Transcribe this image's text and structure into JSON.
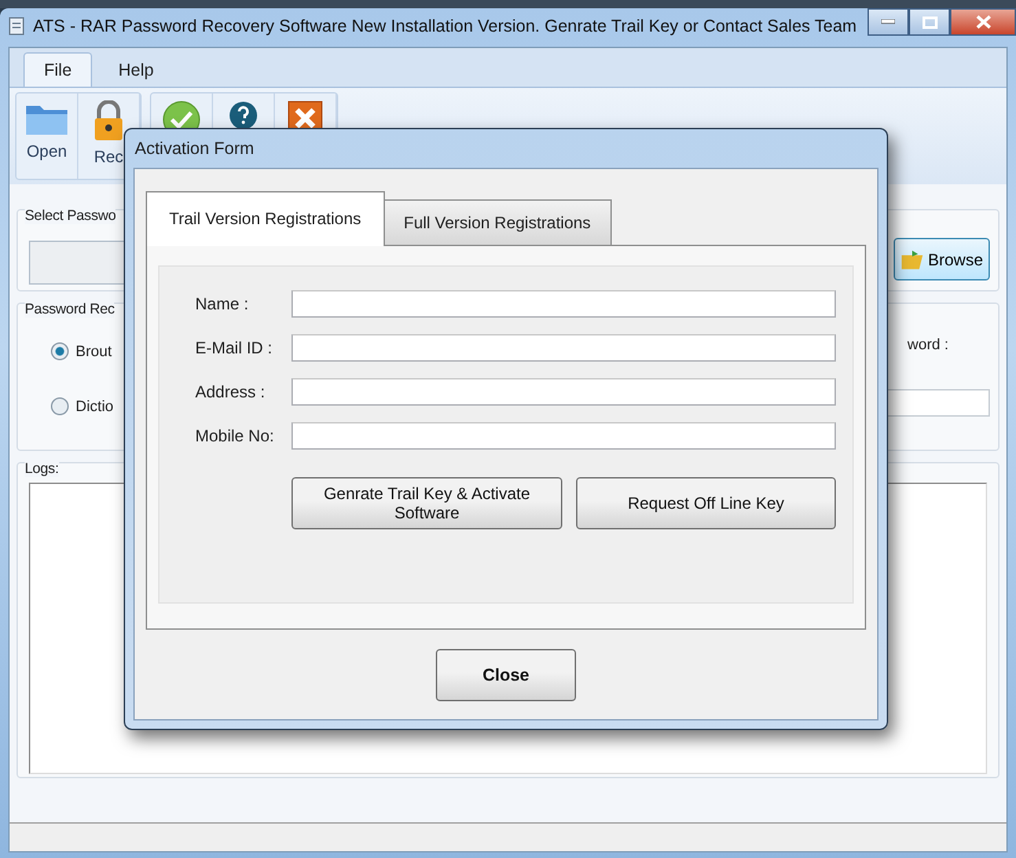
{
  "window": {
    "title": "ATS - RAR Password Recovery Software New Installation Version. Genrate Trail Key or Contact Sales Team"
  },
  "menu_tabs": [
    {
      "label": "File",
      "selected": true
    },
    {
      "label": "Help",
      "selected": false
    }
  ],
  "ribbon_buttons": [
    {
      "kind": "open",
      "label": "Open"
    },
    {
      "kind": "lock",
      "label": "Rec"
    },
    {
      "kind": "check"
    },
    {
      "kind": "help"
    },
    {
      "kind": "exit"
    }
  ],
  "select_password": {
    "label": "Select Passwo",
    "browse": "Browse"
  },
  "recovery": {
    "title": "Password Rec",
    "radios": [
      {
        "label": "Brout",
        "selected": true
      },
      {
        "label": "Dictio",
        "selected": false
      }
    ],
    "right_label": "word :"
  },
  "logs": {
    "label": "Logs:"
  },
  "dialog": {
    "title": "Activation Form",
    "tabs": [
      {
        "label": "Trail Version Registrations",
        "selected": true
      },
      {
        "label": "Full Version Registrations",
        "selected": false
      }
    ],
    "fields": [
      {
        "label": "Name :"
      },
      {
        "label": "E-Mail ID :"
      },
      {
        "label": "Address :"
      },
      {
        "label": "Mobile No:"
      }
    ],
    "buttons": [
      "Genrate Trail Key & Activate Software",
      "Request Off Line Key"
    ],
    "close": "Close"
  }
}
